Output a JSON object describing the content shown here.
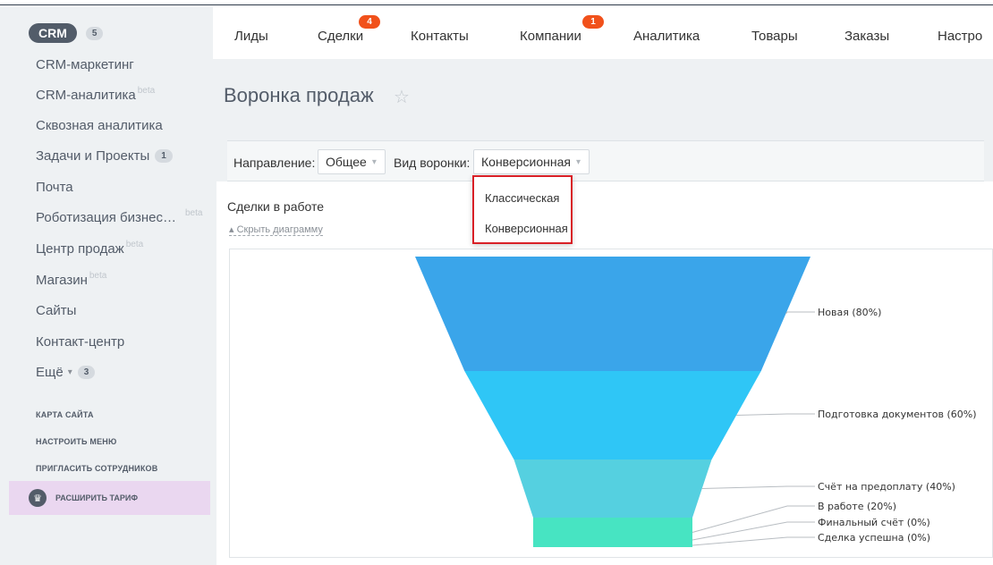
{
  "sidebar": {
    "crm": {
      "label": "CRM",
      "count": "5"
    },
    "items": [
      {
        "label": "CRM-маркетинг",
        "beta": ""
      },
      {
        "label": "CRM-аналитика",
        "beta": "beta"
      },
      {
        "label": "Сквозная аналитика",
        "beta": ""
      },
      {
        "label": "Задачи и Проекты",
        "beta": "",
        "badge": "1"
      },
      {
        "label": "Почта",
        "beta": ""
      },
      {
        "label": "Роботизация бизнес…",
        "beta": "beta"
      },
      {
        "label": "Центр продаж",
        "beta": "beta"
      },
      {
        "label": "Магазин",
        "beta": "beta"
      },
      {
        "label": "Сайты",
        "beta": ""
      },
      {
        "label": "Контакт-центр",
        "beta": ""
      },
      {
        "label": "Ещё",
        "beta": "",
        "badge": "3"
      }
    ],
    "small_links": [
      "КАРТА САЙТА",
      "НАСТРОИТЬ МЕНЮ",
      "ПРИГЛАСИТЬ СОТРУДНИКОВ"
    ],
    "upgrade": {
      "label": "РАСШИРИТЬ ТАРИФ",
      "icon": "crown-icon"
    }
  },
  "topnav": {
    "items": [
      {
        "label": "Лиды"
      },
      {
        "label": "Сделки",
        "badge": "4"
      },
      {
        "label": "Контакты"
      },
      {
        "label": "Компании",
        "badge": "1"
      },
      {
        "label": "Аналитика"
      },
      {
        "label": "Товары"
      },
      {
        "label": "Заказы"
      },
      {
        "label": "Настро"
      }
    ]
  },
  "page": {
    "title": "Воронка продаж",
    "star_icon": "star-icon"
  },
  "filters": {
    "direction_label": "Направление:",
    "direction_value": "Общее",
    "funnel_label": "Вид воронки:",
    "funnel_value": "Конверсионная"
  },
  "dropdown": {
    "options": [
      "Классическая",
      "Конверсионная"
    ]
  },
  "section": {
    "title": "Сделки в работе",
    "hide_link": "Скрыть диаграмму"
  },
  "colors": {
    "accent_badge": "#f1511b",
    "popup_border": "#d92027",
    "sidebar_bg": "#eef1f3"
  },
  "chart_data": {
    "type": "funnel",
    "stages": [
      {
        "name": "Новая",
        "percent": 80,
        "label": "Новая (80%)",
        "color": "#3aa5ea"
      },
      {
        "name": "Подготовка документов",
        "percent": 60,
        "label": "Подготовка документов (60%)",
        "color": "#2fc6f6"
      },
      {
        "name": "Счёт на предоплату",
        "percent": 40,
        "label": "Счёт на предоплату (40%)",
        "color": "#55d0e0"
      },
      {
        "name": "В работе",
        "percent": 20,
        "label": "В работе (20%)",
        "color": "#47e4c2"
      },
      {
        "name": "Финальный счёт",
        "percent": 0,
        "label": "Финальный счёт (0%)",
        "color": "#47e4c2"
      },
      {
        "name": "Сделка успешна",
        "percent": 0,
        "label": "Сделка успешна (0%)",
        "color": "#47e4c2"
      }
    ]
  }
}
